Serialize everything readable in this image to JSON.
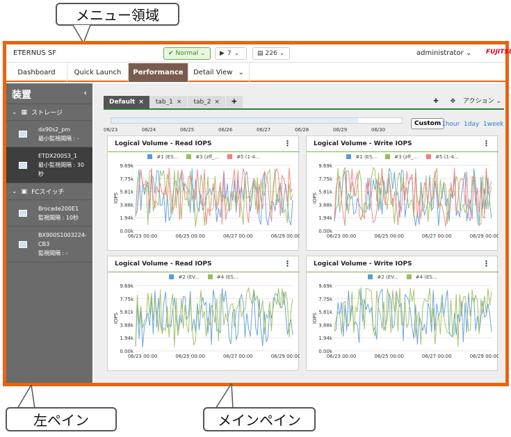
{
  "callouts": {
    "menu": "メニュー領域",
    "left": "左ペイン",
    "main": "メインペイン"
  },
  "topbar": {
    "brand": "ETERNUS SF",
    "status": "Normal",
    "alerts": "7",
    "events": "226",
    "user": "administrator",
    "vendor": "FUJITSU"
  },
  "nav": {
    "dashboard": "Dashboard",
    "quick_launch": "Quick Launch",
    "performance": "Performance",
    "detail_view": "Detail View"
  },
  "left": {
    "title": "装置",
    "storage_group": "ストレージ",
    "fc_group": "FCスイッチ",
    "devices": [
      {
        "name": "dx90s2_pm",
        "info": "最小監視間隔 : -"
      },
      {
        "name": "ETDX200S3_1",
        "info": "最小監視間隔 : 30秒"
      }
    ],
    "switches": [
      {
        "name": "Brocade200E1",
        "info": "監視間隔 : 10秒"
      },
      {
        "name": "BX900S1003224-CB3",
        "info": "監視間隔 : -"
      }
    ]
  },
  "main": {
    "tabs": [
      "Default",
      "tab_1",
      "tab_2"
    ],
    "action_label": "アクション",
    "timeline_dates": [
      "06/23",
      "06/24",
      "06/25",
      "06/26",
      "06/27",
      "06/28",
      "06/29",
      "06/30"
    ],
    "custom": "Custom",
    "ranges": [
      "1hour",
      "1day",
      "1week"
    ]
  },
  "colors": {
    "accent": "#e8650f",
    "s1": "#5b9bd5",
    "s3": "#9bbb59",
    "s5": "#f08080",
    "s2": "#5b9bd5",
    "s4": "#9bbb59"
  },
  "chart_data": [
    {
      "type": "line",
      "title": "Logical Volume - Read IOPS",
      "ylabel": "IOPS",
      "yticks": [
        "9.69k",
        "7.75k",
        "5.81k",
        "3.88k",
        "1.94k",
        "0.00k"
      ],
      "xticks": [
        "06/23 00:00",
        "06/25 00:00",
        "06/27 00:00",
        "06/29 00:00"
      ],
      "ylim": [
        0,
        9690
      ],
      "series": [
        {
          "name": "#1 (ES...",
          "color": "#5b9bd5"
        },
        {
          "name": "#3 (zff_...",
          "color": "#9bbb59"
        },
        {
          "name": "#5 (1-4...",
          "color": "#f08080"
        }
      ]
    },
    {
      "type": "line",
      "title": "Logical Volume - Write IOPS",
      "ylabel": "IOPS",
      "yticks": [
        "9.69k",
        "7.75k",
        "5.81k",
        "3.88k",
        "1.94k",
        "0.00k"
      ],
      "xticks": [
        "06/23 00:00",
        "06/25 00:00",
        "06/27 00:00",
        "06/29 00:00"
      ],
      "ylim": [
        0,
        9690
      ],
      "series": [
        {
          "name": "#1 (ES...",
          "color": "#5b9bd5"
        },
        {
          "name": "#3 (zff_...",
          "color": "#9bbb59"
        },
        {
          "name": "#5 (1-4...",
          "color": "#f08080"
        }
      ]
    },
    {
      "type": "line",
      "title": "Logical Volume - Read IOPS",
      "ylabel": "IOPS",
      "yticks": [
        "9.69k",
        "7.75k",
        "5.81k",
        "3.88k",
        "1.94k",
        "0.00k"
      ],
      "xticks": [
        "06/23 00:00",
        "06/25 00:00",
        "06/27 00:00",
        "06/29 00:00"
      ],
      "ylim": [
        0,
        9690
      ],
      "series": [
        {
          "name": "#2 (EV...",
          "color": "#5b9bd5"
        },
        {
          "name": "#4 (ES...",
          "color": "#9bbb59"
        }
      ]
    },
    {
      "type": "line",
      "title": "Logical Volume - Write IOPS",
      "ylabel": "IOPS",
      "yticks": [
        "9.69k",
        "7.75k",
        "5.81k",
        "3.88k",
        "1.94k",
        "0.00k"
      ],
      "xticks": [
        "06/23 00:00",
        "06/25 00:00",
        "06/27 00:00",
        "06/29 00:00"
      ],
      "ylim": [
        0,
        9690
      ],
      "series": [
        {
          "name": "#2 (EV...",
          "color": "#5b9bd5"
        },
        {
          "name": "#4 (ES...",
          "color": "#9bbb59"
        }
      ]
    }
  ]
}
